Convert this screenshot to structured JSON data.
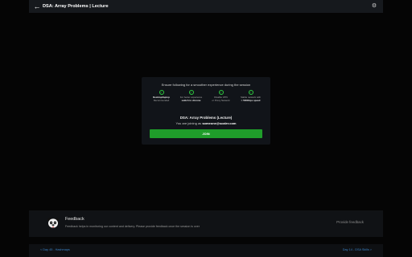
{
  "header": {
    "back_icon": "arrow-left-icon",
    "title": "DSA: Array Problems | Lecture",
    "settings_icon": "gear-icon"
  },
  "prejoin": {
    "headline": "Ensure following for a smoother experience during the session",
    "requirements": [
      {
        "icon": "check-circle-icon",
        "strong": "Desktop/laptop",
        "text": "Recommended"
      },
      {
        "icon": "check-circle-icon",
        "text": "For better experience",
        "strong": "switch to chrome"
      },
      {
        "icon": "check-circle-icon",
        "text": "Disable VPN",
        "text2": "or Proxy Network"
      },
      {
        "icon": "check-circle-icon",
        "text": "Stable network with",
        "strong": "> 500Kbps speed"
      }
    ],
    "session_title": "DSA: Array Problems (Lecture)",
    "joining_prefix": "You are joining as",
    "email": "someone@scaler.com",
    "join_label": "JOIN"
  },
  "feedback": {
    "title": "Feedback",
    "description": "Feedback helps in monitoring our content and delivery. Please provide feedback once the session is over",
    "button_label": "Provide feedback"
  },
  "footer": {
    "prev_label": "< Day 45 - Hashmaps",
    "next_label": "Day 14 - DSA Skills >"
  },
  "colors": {
    "accent_green": "#1f9d2a",
    "link_blue": "#3b82c4",
    "background": "#050505"
  }
}
